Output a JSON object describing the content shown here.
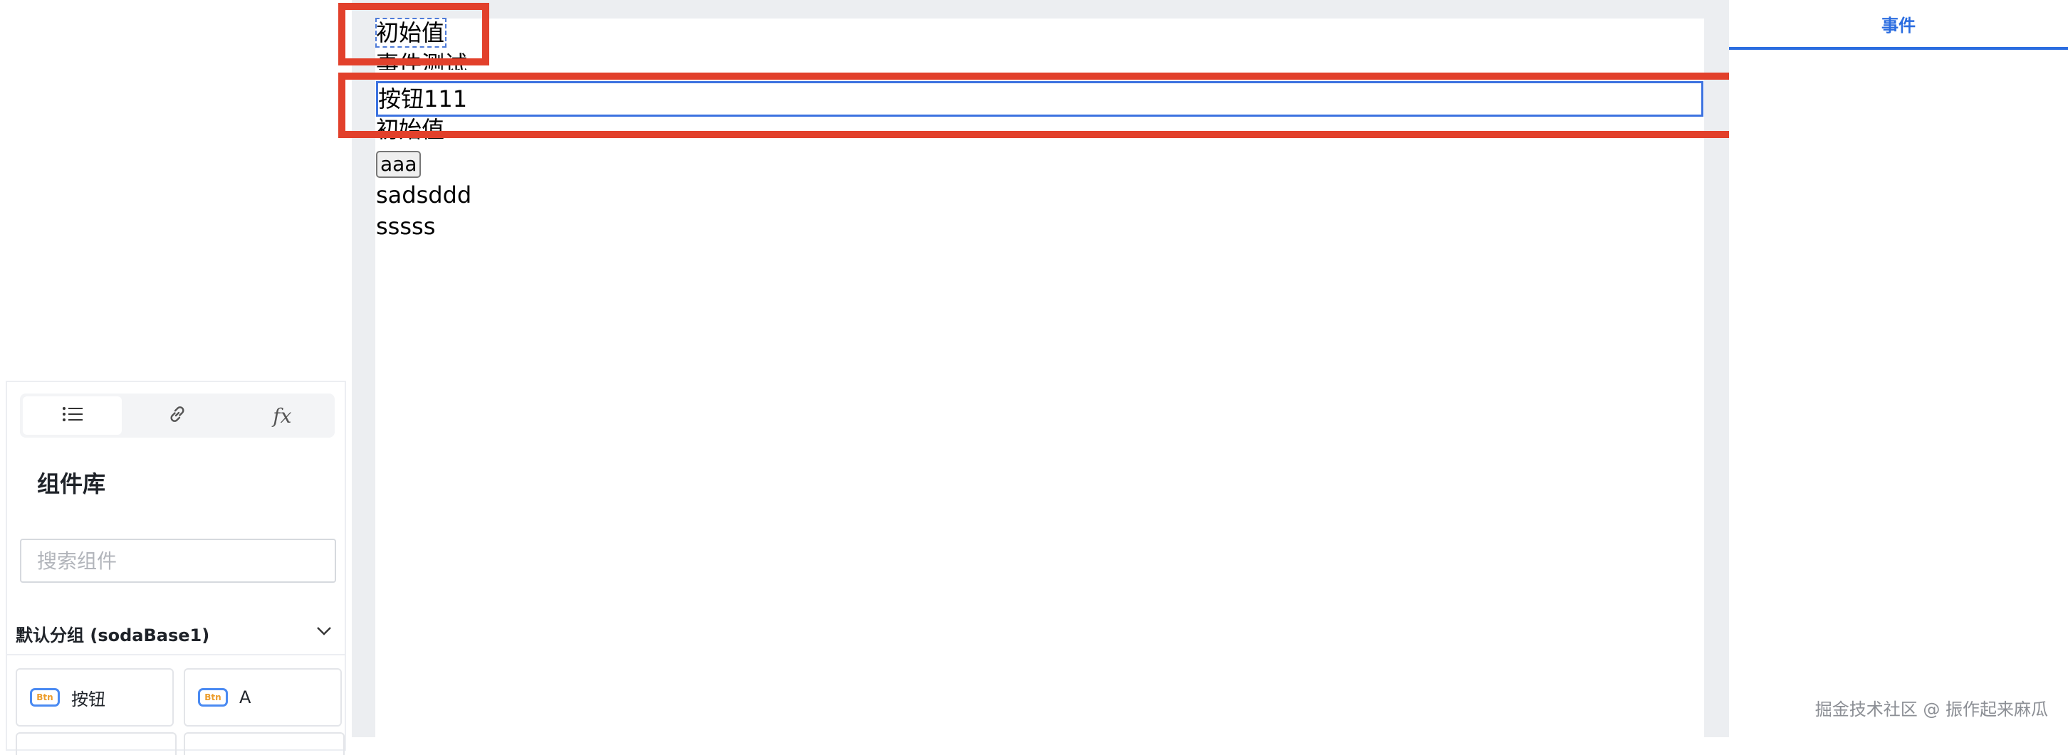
{
  "left_panel": {
    "tabs": [
      {
        "icon": "list-icon"
      },
      {
        "icon": "link-icon"
      },
      {
        "icon": "fx-icon",
        "label": "fx"
      }
    ],
    "title": "组件库",
    "search": {
      "placeholder": "搜索组件",
      "value": ""
    },
    "group": {
      "title": "默认分组 (sodaBase1)",
      "expanded": true
    },
    "components": [
      {
        "icon_text": "Btn",
        "label": "按钮"
      },
      {
        "icon_text": "Btn",
        "label": "A"
      }
    ]
  },
  "canvas": {
    "items": [
      "初始值",
      "事件测试",
      "按钮111",
      "初始值",
      "aaa",
      "sadsddd",
      "sssss"
    ]
  },
  "right_panel": {
    "tab_label": "事件"
  },
  "watermark": "掘金技术社区 @ 振作起来麻瓜",
  "colors": {
    "highlight": "#e2402b",
    "accent": "#2b6de0",
    "selection": "#3c72e0"
  }
}
